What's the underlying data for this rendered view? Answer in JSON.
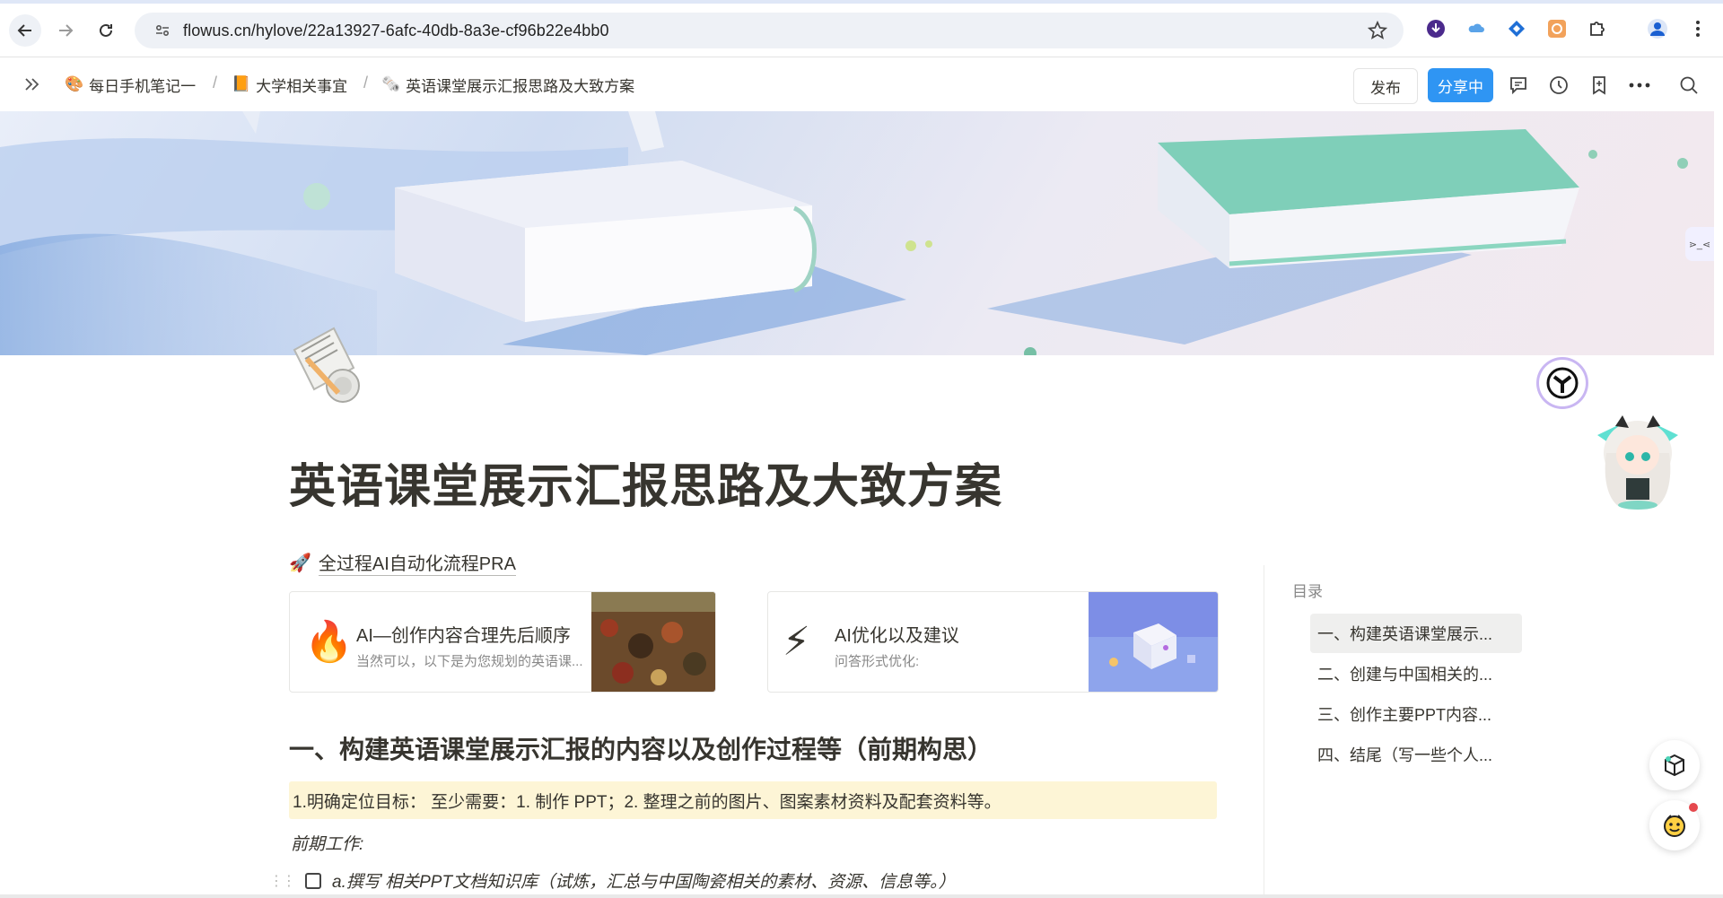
{
  "browser": {
    "url": "flowus.cn/hylove/22a13927-6afc-40db-8a3e-cf96b22e4bb0"
  },
  "breadcrumb": [
    {
      "emoji": "🎨",
      "label": "每日手机笔记一"
    },
    {
      "emoji": "📙",
      "label": "大学相关事宜"
    },
    {
      "emoji": "🗞️",
      "label": "英语课堂展示汇报思路及大致方案"
    }
  ],
  "header": {
    "publish_label": "发布",
    "share_label": "分享中"
  },
  "page": {
    "title": "英语课堂展示汇报思路及大致方案",
    "link": {
      "emoji": "🚀",
      "label": "全过程AI自动化流程PRA"
    },
    "cards": [
      {
        "emoji": "🔥",
        "title": "AI—创作内容合理先后顺序",
        "subtitle": "当然可以，以下是为您规划的英语课..."
      },
      {
        "emoji": "⚡",
        "title": "AI优化以及建议",
        "subtitle": "问答形式优化:"
      }
    ],
    "heading1": "一、构建英语课堂展示汇报的内容以及创作过程等（前期构思）",
    "callout": "1.明确定位目标：  至少需要：1. 制作 PPT；2. 整理之前的图片、图案素材资料及配套资料等。",
    "pre_work_label": "前期工作:",
    "todo_1": "a.撰写 相关PPT文档知识库（试炼，汇总与中国陶瓷相关的素材、资源、信息等。）"
  },
  "toc": {
    "title": "目录",
    "items": [
      "一、构建英语课堂展示...",
      "二、创建与中国相关的...",
      "三、创作主要PPT内容...",
      "四、结尾（写一些个人..."
    ]
  },
  "side_tab_label": "⋗_⋖",
  "colors": {
    "accent": "#2f95f3",
    "callout_bg": "#fdf5d6",
    "text": "#37352f"
  }
}
